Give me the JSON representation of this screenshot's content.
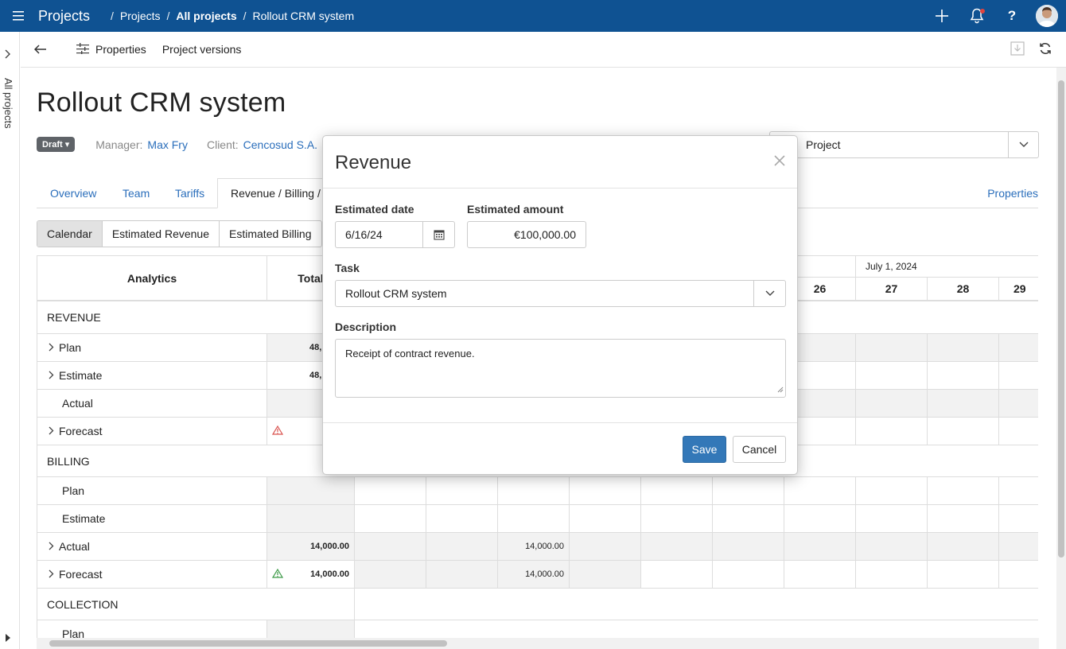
{
  "topbar": {
    "app_title": "Projects",
    "breadcrumbs": [
      "Projects",
      "All projects",
      "Rollout CRM system"
    ],
    "bg_color": "#0f5292"
  },
  "rail": {
    "label": "All projects"
  },
  "toolbar": {
    "properties_label": "Properties",
    "versions_label": "Project versions"
  },
  "page": {
    "title": "Rollout CRM system",
    "status_badge": "Draft",
    "manager_label": "Manager:",
    "manager_value": "Max Fry",
    "client_label": "Client:",
    "client_value": "Cencosud S.A.",
    "project_selector": "Project"
  },
  "tabs": {
    "overview": "Overview",
    "team": "Team",
    "tariffs": "Tariffs",
    "revenue_billing": "Revenue / Billing /",
    "properties": "Properties"
  },
  "segments": [
    "Calendar",
    "Estimated Revenue",
    "Estimated Billing"
  ],
  "grid": {
    "analytics_header": "Analytics",
    "total_header": "Total",
    "month_label": "July 1, 2024",
    "day_numbers": [
      "26",
      "27",
      "28",
      "29"
    ],
    "sections": {
      "revenue": "REVENUE",
      "billing": "BILLING",
      "collection": "COLLECTION"
    },
    "rows": {
      "plan": "Plan",
      "estimate": "Estimate",
      "actual": "Actual",
      "forecast": "Forecast"
    },
    "values": {
      "rev_plan_total": "48,",
      "rev_estimate_total": "48,",
      "bill_actual_total": "14,000.00",
      "bill_forecast_total": "14,000.00",
      "bill_actual_cell": "14,000.00",
      "bill_forecast_cell": "14,000.00"
    }
  },
  "modal": {
    "title": "Revenue",
    "estimated_date_label": "Estimated date",
    "estimated_date_value": "6/16/24",
    "estimated_amount_label": "Estimated amount",
    "estimated_amount_value": "€100,000.00",
    "task_label": "Task",
    "task_value": "Rollout CRM system",
    "description_label": "Description",
    "description_value": "Receipt of contract revenue.",
    "save_label": "Save",
    "cancel_label": "Cancel",
    "primary_color": "#3378b8"
  }
}
